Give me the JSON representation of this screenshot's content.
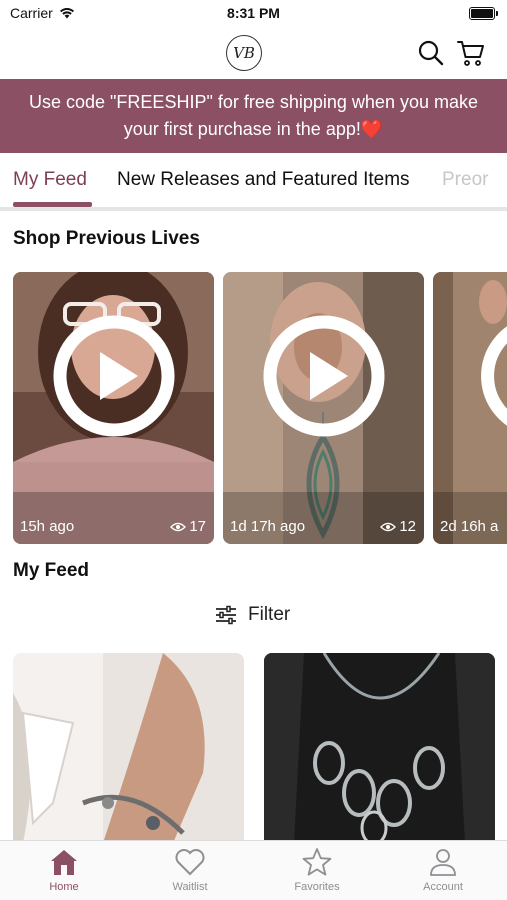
{
  "status_bar": {
    "carrier": "Carrier",
    "time": "8:31 PM"
  },
  "header": {
    "logo_text": "VB"
  },
  "promo": {
    "line1": "Use code \"FREESHIP\" for free shipping when you make",
    "line2": "your first purchase in the app!❤️"
  },
  "tabs": [
    {
      "label": "My Feed",
      "active": true
    },
    {
      "label": "New Releases and Featured Items",
      "active": false
    },
    {
      "label": "Preor",
      "active": false
    }
  ],
  "sections": {
    "previous_lives_title": "Shop Previous Lives",
    "my_feed_title": "My Feed"
  },
  "lives": [
    {
      "ago": "15h ago",
      "views": "17"
    },
    {
      "ago": "1d 17h ago",
      "views": "12"
    },
    {
      "ago": "2d 16h a",
      "views": ""
    }
  ],
  "filter": {
    "label": "Filter"
  },
  "bottom_nav": [
    {
      "label": "Home",
      "icon": "home-icon",
      "active": true
    },
    {
      "label": "Waitlist",
      "icon": "heart-icon",
      "active": false
    },
    {
      "label": "Favorites",
      "icon": "star-icon",
      "active": false
    },
    {
      "label": "Account",
      "icon": "person-icon",
      "active": false
    }
  ],
  "colors": {
    "brand": "#8b5064",
    "active_tab_text": "#7d3f56",
    "inactive_nav": "#8e8e93"
  }
}
